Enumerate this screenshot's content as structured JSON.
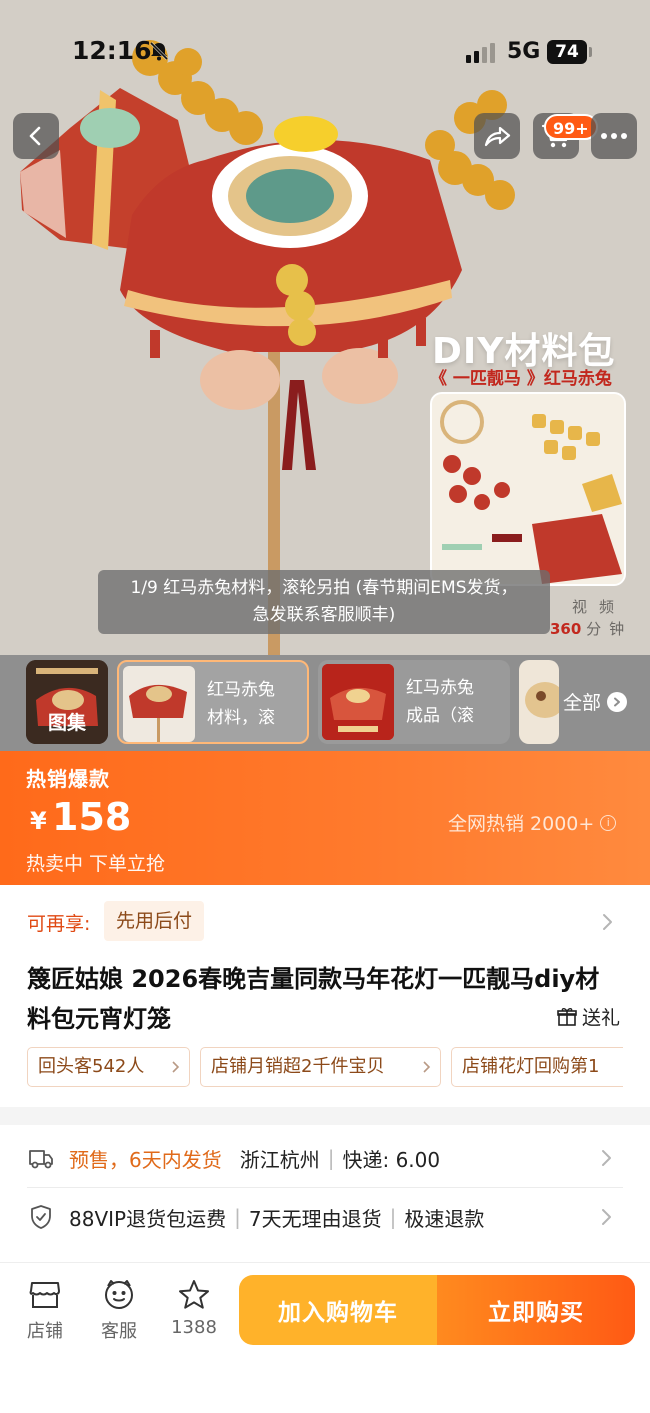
{
  "status_bar": {
    "time": "12:16",
    "network": "5G",
    "battery": "74"
  },
  "toolbar": {
    "cart_badge": "99+"
  },
  "hero": {
    "promo_title": "DIY材料包",
    "promo_subtitle": "《 一匹靓马 》红马赤兔",
    "video_label": "视频",
    "video_duration_num": "360",
    "video_duration_unit": "分钟",
    "caption_line1": "1/9 红马赤兔材料，滚轮另拍 (春节期间EMS发货，",
    "caption_line2": "急发联系客服顺丰)"
  },
  "gallery": {
    "album_label": "图集",
    "thumbs": [
      {
        "line1": "红马赤兔",
        "line2": "材料，滚"
      },
      {
        "line1": "红马赤兔",
        "line2": "成品（滚"
      }
    ],
    "all_label": "全部"
  },
  "price": {
    "badge": "热销爆款",
    "currency": "¥",
    "amount": "158",
    "status": "热卖中 下单立抢",
    "sales": "全网热销 2000+"
  },
  "details": {
    "credit_label": "可再享:",
    "credit_tag": "先用后付",
    "title": "篾匠姑娘 2026春晚吉量同款马年花灯一匹靓马diy材料包元宵灯笼",
    "gift_label": "送礼",
    "chips": [
      "回头客542人",
      "店铺月销超2千件宝贝",
      "店铺花灯回购第1"
    ]
  },
  "service": {
    "presale": "预售，6天内发货",
    "origin": "浙江杭州",
    "shipping": "快递: 6.00",
    "guarantees": [
      "88VIP退货包运费",
      "7天无理由退货",
      "极速退款"
    ]
  },
  "bottom_bar": {
    "store": "店铺",
    "service": "客服",
    "favorites": "1388",
    "add_to_cart": "加入购物车",
    "buy_now": "立即购买"
  },
  "colors": {
    "accent": "#ff6a1a",
    "cart_button": "#ffb22a",
    "buy_button": "#ff5a14",
    "presale_text": "#e06a1a"
  }
}
